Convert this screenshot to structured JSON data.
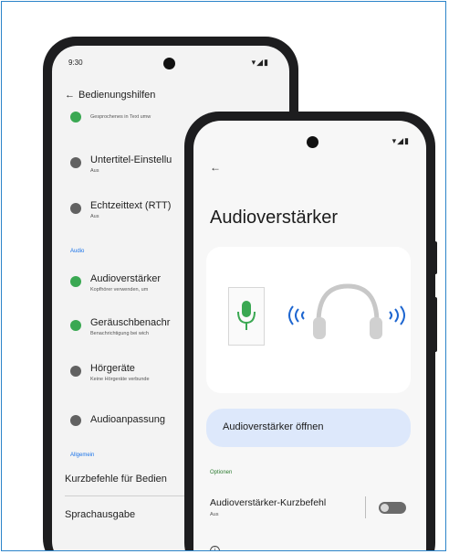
{
  "back_screen": {
    "time": "9:30",
    "signal": "▾◢▮",
    "appbar_title": "Bedienungshilfen",
    "items": [
      {
        "title": "",
        "subtitle": "Gesprochenes in Text umw",
        "color": "#3aa852"
      },
      {
        "title": "Untertitel-Einstellu",
        "subtitle": "Aus",
        "color": "#616161"
      },
      {
        "title": "Echtzeittext (RTT)",
        "subtitle": "Aus",
        "color": "#616161"
      },
      {
        "title": "Audioverstärker",
        "subtitle": "Kopfhörer verwenden, um",
        "color": "#3aa852"
      },
      {
        "title": "Geräuschbenachr",
        "subtitle": "Benachrichtigung bei wich",
        "color": "#3aa852"
      },
      {
        "title": "Hörgeräte",
        "subtitle": "Keine Hörgeräte verbunde",
        "color": "#616161"
      },
      {
        "title": "Audioanpassung",
        "subtitle": "",
        "color": "#616161"
      }
    ],
    "section_audio": "Audio",
    "section_general": "Allgemein",
    "plain_items": [
      "Kurzbefehle für Bedien",
      "Sprachausgabe"
    ]
  },
  "front_screen": {
    "signal": "▾◢▮",
    "title": "Audioverstärker",
    "open_button": "Audioverstärker öffnen",
    "section_options": "Optionen",
    "shortcut_title": "Audioverstärker-Kurzbefehl",
    "shortcut_status": "Aus",
    "shortcut_enabled": false,
    "info_glyph": "i"
  },
  "colors": {
    "accent_blue": "#1a73e8",
    "accent_green": "#3aa852",
    "pill_bg": "#dde8fb",
    "mic_green": "#3aa852",
    "waves_blue": "#1e66d0"
  }
}
